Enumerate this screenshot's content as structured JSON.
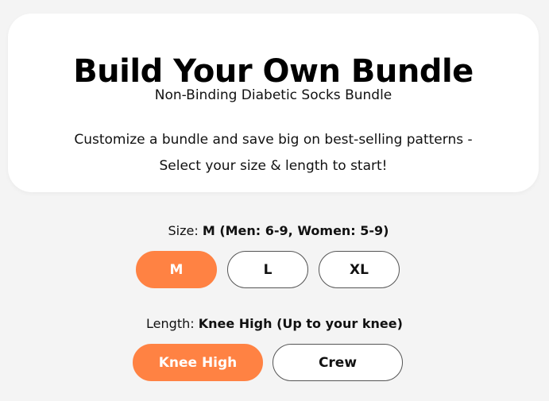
{
  "header": {
    "title": "Build Your Own Bundle",
    "subtitle": "Non-Binding Diabetic Socks Bundle",
    "description_line1": "Customize a bundle and save big on best-selling patterns -",
    "description_line2": "Select your size & length to start!"
  },
  "size": {
    "label": "Size:",
    "selected_text": "M (Men: 6-9, Women: 5-9)",
    "options": [
      "M",
      "L",
      "XL"
    ],
    "selected": "M"
  },
  "length": {
    "label": "Length:",
    "selected_text": "Knee High (Up to your knee)",
    "options": [
      "Knee High",
      "Crew"
    ],
    "selected": "Knee High"
  },
  "colors": {
    "accent": "#ff8243",
    "card_bg": "#ffffff",
    "page_bg": "#f4f4f4"
  }
}
